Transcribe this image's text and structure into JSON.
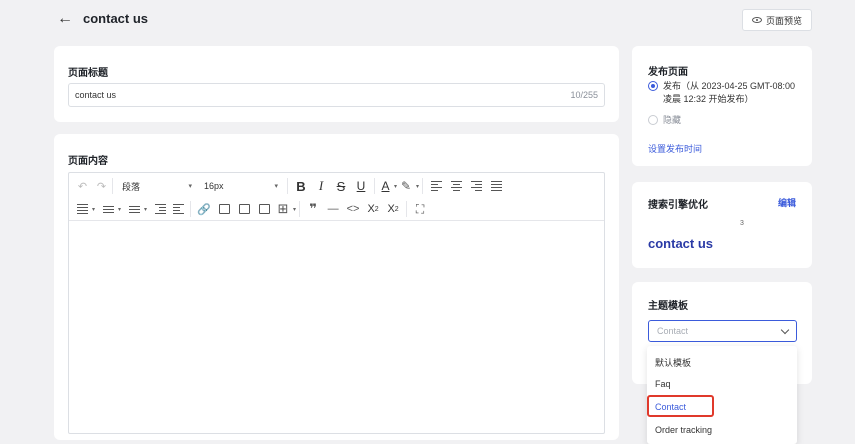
{
  "header": {
    "back_icon": "arrow-left-icon",
    "title": "contact us",
    "preview_label": "页面预览"
  },
  "page_title_card": {
    "label": "页面标题",
    "value": "contact us",
    "count": "10/255"
  },
  "content_card": {
    "label": "页面内容",
    "toolbar": {
      "paragraph": "段落",
      "font_size": "16px",
      "bold": "B",
      "italic": "I",
      "strike": "S",
      "underline": "U",
      "font_color": "A",
      "quote": "❞",
      "hr": "—",
      "code": "<>",
      "superscript": "X",
      "subscript": "X"
    }
  },
  "publish": {
    "label": "发布页面",
    "option_publish": "发布（从 2023-04-25 GMT-08:00 凌晨 12:32 开始发布）",
    "option_hide": "隐藏",
    "set_time_link": "设置发布时间"
  },
  "seo": {
    "label": "搜索引擎优化",
    "edit": "编辑",
    "url_fragment": "3",
    "title": "contact us"
  },
  "theme": {
    "label": "主题模板",
    "placeholder": "Contact",
    "options": [
      "默认模板",
      "Faq",
      "Contact",
      "Order tracking"
    ]
  },
  "colors": {
    "accent": "#3b5bdb",
    "highlight": "#e0392b",
    "background": "#f1f1f3"
  }
}
